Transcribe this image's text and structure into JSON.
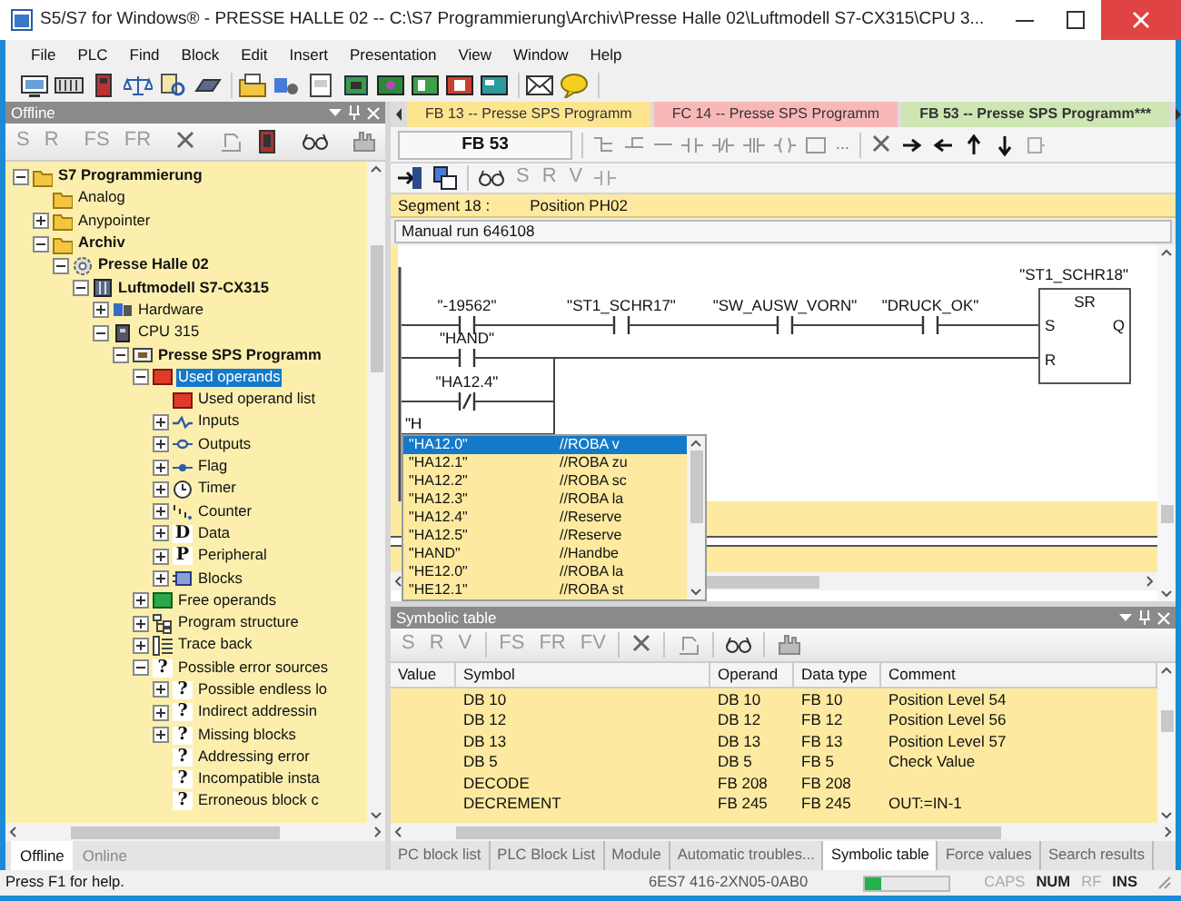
{
  "window": {
    "title": "S5/S7 for Windows® - PRESSE HALLE 02 -- C:\\S7 Programmierung\\Archiv\\Presse Halle 02\\Luftmodell S7-CX315\\CPU 3..."
  },
  "menu": [
    "File",
    "PLC",
    "Find",
    "Block",
    "Edit",
    "Insert",
    "Presentation",
    "View",
    "Window",
    "Help"
  ],
  "offline_panel": {
    "title": "Offline",
    "toolbar": [
      {
        "label": "S",
        "disabled": true
      },
      {
        "label": "R",
        "disabled": true
      },
      {
        "label": "FS",
        "disabled": true
      },
      {
        "label": "FR",
        "disabled": true
      }
    ],
    "tree": [
      {
        "label": "S7 Programmierung",
        "kind": "folder",
        "bold": true,
        "expanded": true,
        "selected": false,
        "children": [
          {
            "label": "Analog",
            "kind": "folder",
            "selected": false
          },
          {
            "label": "Anypointer",
            "kind": "folder",
            "expanded": false,
            "selected": false
          },
          {
            "label": "Archiv",
            "kind": "folder",
            "bold": true,
            "expanded": true,
            "selected": false,
            "children": [
              {
                "label": "Presse Halle 02",
                "kind": "gear",
                "bold": true,
                "expanded": true,
                "selected": false,
                "children": [
                  {
                    "label": "Luftmodell S7-CX315",
                    "kind": "station",
                    "bold": true,
                    "expanded": true,
                    "selected": false,
                    "children": [
                      {
                        "label": "Hardware",
                        "kind": "hardware",
                        "expanded": false,
                        "selected": false
                      },
                      {
                        "label": "CPU 315",
                        "kind": "cpu",
                        "expanded": true,
                        "selected": false,
                        "children": [
                          {
                            "label": "Presse SPS Programm",
                            "kind": "program",
                            "bold": true,
                            "expanded": true,
                            "selected": false,
                            "children": [
                              {
                                "label": "Used operands",
                                "kind": "red",
                                "expanded": true,
                                "selected": true,
                                "children": [
                                  {
                                    "label": "Used operand list",
                                    "kind": "red",
                                    "selected": false
                                  },
                                  {
                                    "label": "Inputs",
                                    "kind": "input",
                                    "expanded": false,
                                    "selected": false
                                  },
                                  {
                                    "label": "Outputs",
                                    "kind": "output",
                                    "expanded": false,
                                    "selected": false
                                  },
                                  {
                                    "label": "Flag",
                                    "kind": "flag",
                                    "expanded": false,
                                    "selected": false
                                  },
                                  {
                                    "label": "Timer",
                                    "kind": "timer",
                                    "expanded": false,
                                    "selected": false
                                  },
                                  {
                                    "label": "Counter",
                                    "kind": "counter",
                                    "expanded": false,
                                    "selected": false
                                  },
                                  {
                                    "label": "Data",
                                    "kind": "glyph",
                                    "glyph": "D",
                                    "expanded": false,
                                    "selected": false
                                  },
                                  {
                                    "label": "Peripheral",
                                    "kind": "glyph",
                                    "glyph": "P",
                                    "expanded": false,
                                    "selected": false
                                  },
                                  {
                                    "label": "Blocks",
                                    "kind": "blocks",
                                    "expanded": false,
                                    "selected": false
                                  }
                                ]
                              },
                              {
                                "label": "Free operands",
                                "kind": "green",
                                "expanded": false,
                                "selected": false
                              },
                              {
                                "label": "Program structure",
                                "kind": "structure",
                                "expanded": false,
                                "selected": false
                              },
                              {
                                "label": "Trace back",
                                "kind": "trace",
                                "expanded": false,
                                "selected": false
                              },
                              {
                                "label": "Possible error sources",
                                "kind": "glyph",
                                "glyph": "?",
                                "expanded": true,
                                "selected": false,
                                "children": [
                                  {
                                    "label": "Possible endless lo",
                                    "kind": "glyph",
                                    "glyph": "?",
                                    "expanded": false,
                                    "selected": false
                                  },
                                  {
                                    "label": "Indirect addressin",
                                    "kind": "glyph",
                                    "glyph": "?",
                                    "expanded": false,
                                    "selected": false
                                  },
                                  {
                                    "label": "Missing blocks",
                                    "kind": "glyph",
                                    "glyph": "?",
                                    "expanded": false,
                                    "selected": false
                                  },
                                  {
                                    "label": "Addressing error",
                                    "kind": "glyph",
                                    "glyph": "?",
                                    "selected": false
                                  },
                                  {
                                    "label": "Incompatible insta",
                                    "kind": "glyph",
                                    "glyph": "?",
                                    "selected": false
                                  },
                                  {
                                    "label": "Erroneous block c",
                                    "kind": "glyph",
                                    "glyph": "?",
                                    "selected": false
                                  }
                                ]
                              }
                            ]
                          }
                        ]
                      }
                    ]
                  }
                ]
              }
            ]
          }
        ]
      }
    ],
    "tabs": [
      {
        "label": "Offline",
        "selected": true
      },
      {
        "label": "Online",
        "selected": false
      }
    ]
  },
  "editor": {
    "tabs": [
      {
        "label": "FB 13 -- Presse SPS Programm",
        "color": "#fde58f",
        "selected": false
      },
      {
        "label": "FC 14 -- Presse SPS Programm",
        "color": "#f9b8b8",
        "selected": false
      },
      {
        "label": "FB 53 -- Presse SPS Programm***",
        "color": "#cfe6b4",
        "selected": true
      }
    ],
    "block": "FB 53",
    "more": "...",
    "toolbar": [
      {
        "label": "S",
        "disabled": true
      },
      {
        "label": "R",
        "disabled": true
      },
      {
        "label": "V",
        "disabled": true
      }
    ],
    "segment": {
      "number": "Segment 18 :",
      "title": "Position PH02",
      "comment": "Manual run 646108"
    },
    "ladder": {
      "contacts": [
        {
          "label": "\"-19562\"",
          "kind": "normal"
        },
        {
          "label": "\"ST1_SCHR17\"",
          "kind": "normal"
        },
        {
          "label": "\"SW_AUSW_VORN\"",
          "kind": "normal"
        },
        {
          "label": "\"DRUCK_OK\"",
          "kind": "normal"
        },
        {
          "label": "\"HAND\"",
          "kind": "normal"
        },
        {
          "label": "\"HA12.4\"",
          "kind": "negated"
        }
      ],
      "block": {
        "name": "\"ST1_SCHR18\"",
        "type": "SR",
        "set": "S",
        "reset": "R",
        "output": "Q"
      },
      "input": "\"H"
    },
    "autocomplete": [
      {
        "symbol": "\"HA12.0\"",
        "comment": "//ROBA v",
        "selected": true
      },
      {
        "symbol": "\"HA12.1\"",
        "comment": "//ROBA zu",
        "selected": false
      },
      {
        "symbol": "\"HA12.2\"",
        "comment": "//ROBA sc",
        "selected": false
      },
      {
        "symbol": "\"HA12.3\"",
        "comment": "//ROBA la",
        "selected": false
      },
      {
        "symbol": "\"HA12.4\"",
        "comment": "//Reserve",
        "selected": false
      },
      {
        "symbol": "\"HA12.5\"",
        "comment": "//Reserve",
        "selected": false
      },
      {
        "symbol": "\"HAND\"",
        "comment": "//Handbe",
        "selected": false
      },
      {
        "symbol": "\"HE12.0\"",
        "comment": "//ROBA la",
        "selected": false
      },
      {
        "symbol": "\"HE12.1\"",
        "comment": "//ROBA st",
        "selected": false
      }
    ]
  },
  "symbol_table": {
    "title": "Symbolic table",
    "toolbar": [
      {
        "label": "S",
        "disabled": true
      },
      {
        "label": "R",
        "disabled": true
      },
      {
        "label": "V",
        "disabled": true
      },
      {
        "label": "FS",
        "disabled": true
      },
      {
        "label": "FR",
        "disabled": true
      },
      {
        "label": "FV",
        "disabled": true
      }
    ],
    "columns": [
      "Value",
      "Symbol",
      "Operand",
      "Data type",
      "Comment"
    ],
    "rows": [
      [
        "",
        "DB 10",
        "DB 10",
        "FB 10",
        "Position Level 54"
      ],
      [
        "",
        "DB 12",
        "DB 12",
        "FB 12",
        "Position Level 56"
      ],
      [
        "",
        "DB 13",
        "DB 13",
        "FB 13",
        "Position Level 57"
      ],
      [
        "",
        "DB 5",
        "DB 5",
        "FB 5",
        "Check Value"
      ],
      [
        "",
        "DECODE",
        "FB 208",
        "FB 208",
        ""
      ],
      [
        "",
        "DECREMENT",
        "FB 245",
        "FB 245",
        "OUT:=IN-1"
      ]
    ]
  },
  "bottom_tabs": [
    {
      "label": "PC block list",
      "selected": false
    },
    {
      "label": "PLC Block List",
      "selected": false
    },
    {
      "label": "Module",
      "selected": false
    },
    {
      "label": "Automatic troubles...",
      "selected": false
    },
    {
      "label": "Symbolic table",
      "selected": true
    },
    {
      "label": "Force values",
      "selected": false
    },
    {
      "label": "Search results",
      "selected": false
    }
  ],
  "status_bar": {
    "help": "Press F1 for help.",
    "order_number": "6ES7 416-2XN05-0AB0",
    "level": 0.2,
    "indicators": [
      {
        "label": "CAPS",
        "on": false
      },
      {
        "label": "NUM",
        "on": true
      },
      {
        "label": "RF",
        "on": false
      },
      {
        "label": "INS",
        "on": true
      }
    ]
  }
}
